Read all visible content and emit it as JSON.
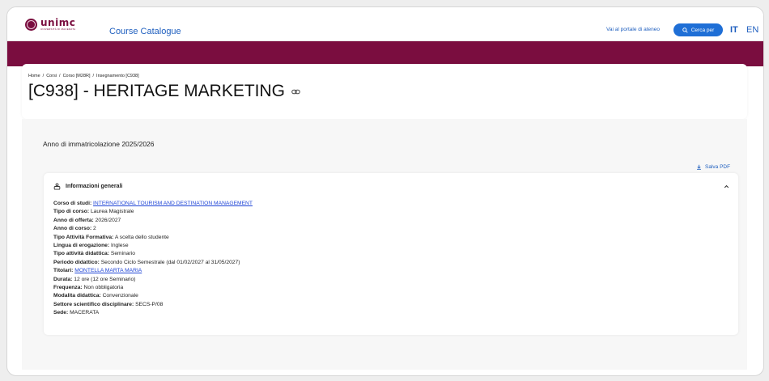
{
  "header": {
    "logo_word": "unimc",
    "logo_sub": "UNIVERSITÀ DI MACERATA",
    "catalogue_label": "Course Catalogue",
    "portal_link": "Vai al portale di ateneo",
    "search_label": "Cerca per",
    "lang_it": "IT",
    "lang_en": "EN"
  },
  "breadcrumb": {
    "items": [
      "Home",
      "Corsi",
      "Corso [M28R]",
      "Insegnamento [C938]"
    ],
    "sep": "/"
  },
  "page": {
    "title": "[C938] - HERITAGE MARKETING",
    "year_label": "Anno di immatricolazione 2025/2026",
    "pdf_label": "Salva PDF"
  },
  "panel": {
    "title": "Informazioni generali",
    "rows": [
      {
        "key": "Corso di studi:",
        "value": "INTERNATIONAL TOURISM AND DESTINATION MANAGEMENT",
        "link": true
      },
      {
        "key": "Tipo di corso:",
        "value": "Laurea Magistrale"
      },
      {
        "key": "Anno di offerta:",
        "value": "2026/2027"
      },
      {
        "key": "Anno di corso:",
        "value": "2"
      },
      {
        "key": "Tipo Attività Formativa:",
        "value": "A scelta dello studente"
      },
      {
        "key": "Lingua di erogazione:",
        "value": "Inglese"
      },
      {
        "key": "Tipo attività didattica:",
        "value": "Seminario"
      },
      {
        "key": "Periodo didattico:",
        "value": "Secondo Ciclo Semestrale (dal 01/02/2027 al 31/05/2027)"
      },
      {
        "key": "Titolari:",
        "value": "MONTELLA MARTA MARIA",
        "link": true
      },
      {
        "key": "Durata:",
        "value": "12 ore (12 ore Seminario)"
      },
      {
        "key": "Frequenza:",
        "value": "Non obbligatoria"
      },
      {
        "key": "Modalita didattica:",
        "value": "Convenzionale"
      },
      {
        "key": "Settore scientifico disciplinare:",
        "value": "SECS-P/08"
      },
      {
        "key": "Sede:",
        "value": "MACERATA"
      }
    ]
  },
  "colors": {
    "brand": "#7a0d3f",
    "link": "#1f45d6",
    "accent": "#1f6fd6"
  }
}
